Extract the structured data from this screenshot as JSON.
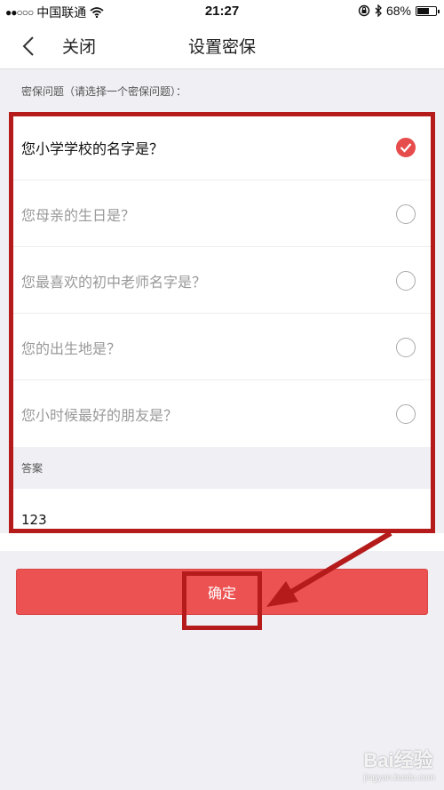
{
  "status_bar": {
    "carrier": "中国联通",
    "time": "21:27",
    "battery": "68%",
    "battery_level": 0.68
  },
  "nav": {
    "close_label": "关闭",
    "title": "设置密保"
  },
  "section_hint": "密保问题（请选择一个密保问题）：",
  "questions": [
    {
      "label": "您小学学校的名字是？",
      "selected": true
    },
    {
      "label": "您母亲的生日是？",
      "selected": false
    },
    {
      "label": "您最喜欢的初中老师名字是？",
      "selected": false
    },
    {
      "label": "您的出生地是？",
      "selected": false
    },
    {
      "label": "您小时候最好的朋友是？",
      "selected": false
    }
  ],
  "answer": {
    "label": "答案",
    "value": "123"
  },
  "confirm_label": "确定",
  "accent_color": "#ec5252",
  "annotation_color": "#b51b1b",
  "watermark": {
    "brand": "Bai经验",
    "url": "jingyan.baidu.com"
  }
}
